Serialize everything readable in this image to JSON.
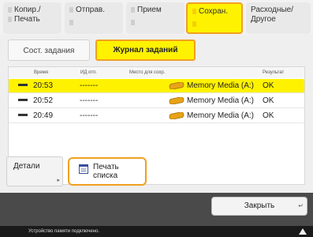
{
  "top_tabs": [
    {
      "line1": "Копир./",
      "line2": "Печать",
      "selected": false
    },
    {
      "line1": "Отправ.",
      "line2": "",
      "selected": false
    },
    {
      "line1": "Прием",
      "line2": "",
      "selected": false
    },
    {
      "line1": "Сохран.",
      "line2": "",
      "selected": true
    },
    {
      "line1": "Расходные/",
      "line2": "Другое",
      "selected": false
    }
  ],
  "sub_tabs": {
    "status": "Сост. задания",
    "log": "Журнал заданий"
  },
  "table": {
    "headers": [
      "Время",
      "ИД отп.",
      "Место для сохр.",
      "Результат"
    ],
    "rows": [
      {
        "time": "20:53",
        "id": "-------",
        "location": "Memory Media (A:)",
        "result": "OK",
        "selected": true
      },
      {
        "time": "20:52",
        "id": "-------",
        "location": "Memory Media (A:)",
        "result": "OK",
        "selected": false
      },
      {
        "time": "20:49",
        "id": "-------",
        "location": "Memory Media (A:)",
        "result": "OK",
        "selected": false
      }
    ]
  },
  "actions": {
    "details": "Детали",
    "print_list_line1": "Печать",
    "print_list_line2": "списка",
    "close": "Закрыть"
  },
  "status_text": "Устройство памяти подключено.",
  "colors": {
    "highlight": "#fff200",
    "focus_border": "#f0a020"
  },
  "icons": {
    "memory_media": "memory-media-icon",
    "print_list": "list-print-icon",
    "status": "warning-triangle-icon"
  }
}
